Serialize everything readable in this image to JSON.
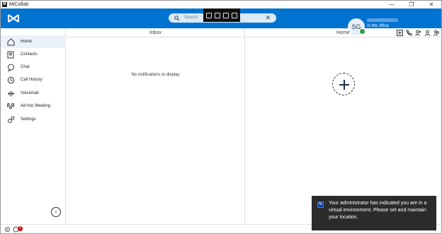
{
  "window": {
    "title": "MiCollab",
    "controls": [
      "—",
      "❐",
      "✕"
    ]
  },
  "header": {
    "search_placeholder": "Search",
    "avatar_initials": "SG",
    "presence_status": "In the office",
    "colors": {
      "brand": "#0073d1",
      "presence": "#2ea043"
    }
  },
  "sidebar": {
    "items": [
      {
        "label": "Home",
        "icon": "home-icon",
        "active": true
      },
      {
        "label": "Contacts",
        "icon": "contacts-icon"
      },
      {
        "label": "Chat",
        "icon": "chat-icon"
      },
      {
        "label": "Call History",
        "icon": "history-icon"
      },
      {
        "label": "Voicemail",
        "icon": "voicemail-icon"
      },
      {
        "label": "Ad-hoc Meeting",
        "icon": "meeting-icon"
      },
      {
        "label": "Settings",
        "icon": "gear-icon"
      }
    ]
  },
  "inbox": {
    "title": "Inbox",
    "empty_message": "No notifications to display"
  },
  "home": {
    "title": "Home"
  },
  "footer": {
    "badge_count": "1"
  },
  "toast": {
    "message": "Your administrator has indicated you are in a virtual environment. Please set and maintain your location."
  }
}
